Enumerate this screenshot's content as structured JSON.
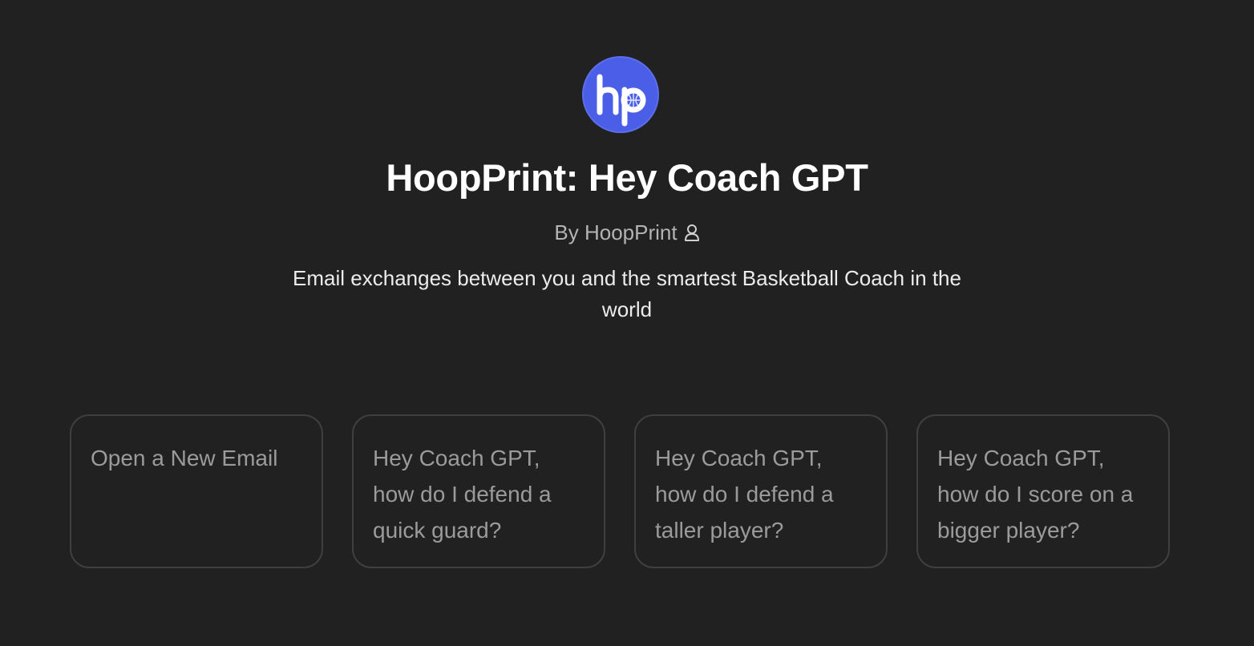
{
  "gpt": {
    "logo_icon": "hooprint-logo-icon",
    "logo_text": "hp",
    "logo_color": "#4a5ee8",
    "title": "HoopPrint: Hey Coach GPT",
    "byline": "By HoopPrint",
    "byline_icon": "person-icon",
    "description": "Email exchanges between you and the smartest Basketball Coach in the world"
  },
  "prompts": [
    {
      "label": "Open a New Email"
    },
    {
      "label": "Hey Coach GPT, how do I defend a quick guard?"
    },
    {
      "label": "Hey Coach GPT, how do I defend a taller player?"
    },
    {
      "label": "Hey Coach GPT, how do I score on a bigger player?"
    }
  ],
  "colors": {
    "background": "#212121",
    "title": "#ffffff",
    "byline": "#b4b4b4",
    "description": "#ececec",
    "card_border": "#3f3f3f",
    "card_text": "#9b9b9b"
  }
}
